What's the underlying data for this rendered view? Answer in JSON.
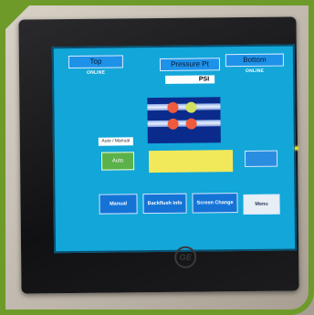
{
  "screen": {
    "header": {
      "left_button": "Top",
      "left_status": "ONLINE",
      "center_button": "Pressure Pt",
      "center_value": "PSI",
      "right_button": "Bottom",
      "right_status": "ONLINE"
    },
    "auto_manual_label": "Auto / Manual",
    "auto_button": "Auto",
    "message_box": "",
    "side_button": "",
    "bottom_buttons": [
      "Manual",
      "Backflush Info",
      "Screen Change",
      "Menu"
    ]
  },
  "colors": {
    "screen_bg": "#13a6d8",
    "valve_red": "#f05a3c",
    "valve_yellow": "#d4e060",
    "auto_green": "#5cb24a",
    "message_yellow": "#f2e95a",
    "frame_green": "#6e9a2a"
  },
  "device": {
    "brand_logo": "ge-logo-icon"
  }
}
